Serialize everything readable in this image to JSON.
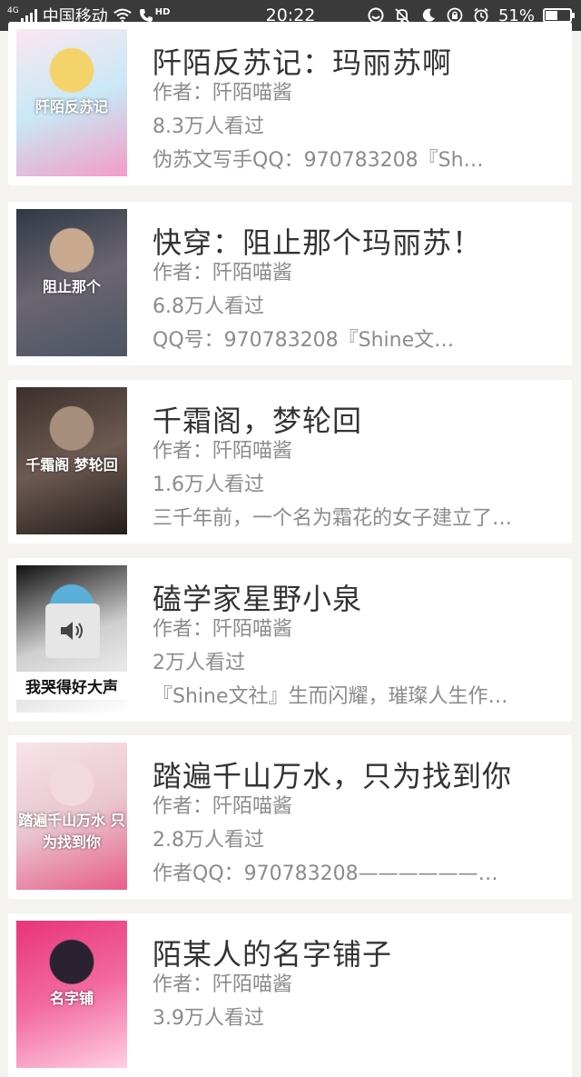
{
  "status_bar": {
    "network_tag": "4G",
    "carrier": "中国移动",
    "hd_tag": "HD",
    "time": "20:22",
    "battery_percent": "51%",
    "battery_level": 0.51,
    "icons": [
      "signal-icon",
      "wifi-icon",
      "call-icon",
      "face-icon",
      "mute-icon",
      "moon-icon",
      "lock-rotate-icon",
      "alarm-icon",
      "battery-icon"
    ]
  },
  "books": [
    {
      "title": "阡陌反苏记：玛丽苏啊",
      "author": "作者：阡陌喵酱",
      "views": "8.3万人看过",
      "desc": "伪苏文写手QQ：970783208『Sh…",
      "cover_text": "阡陌反苏记",
      "cover_colors": [
        "#fbe7f0",
        "#c9e8f6",
        "#f5d36b",
        "#f39cc6"
      ]
    },
    {
      "title": "快穿：阻止那个玛丽苏！",
      "author": "作者：阡陌喵酱",
      "views": "6.8万人看过",
      "desc": "QQ号：970783208『Shine文…",
      "cover_text": "阻止那个",
      "cover_colors": [
        "#2f3945",
        "#6b6570",
        "#c9a98f",
        "#4c5563"
      ]
    },
    {
      "title": "千霜阁，梦轮回",
      "author": "作者：阡陌喵酱",
      "views": "1.6万人看过",
      "desc": "三千年前，一个名为霜花的女子建立了…",
      "cover_text": "千霜阁 梦轮回",
      "cover_colors": [
        "#3b2f2c",
        "#6d5a52",
        "#a88f7c",
        "#241d1c"
      ]
    },
    {
      "title": "磕学家星野小泉",
      "author": "作者：阡陌喵酱",
      "views": "2万人看过",
      "desc": "『Shine文社』生而闪耀，璀璨人生作…",
      "cover_text": "我哭得好大声",
      "cover_colors": [
        "#111111",
        "#cfcfcf",
        "#5ab0d8",
        "#ffffff"
      ]
    },
    {
      "title": "踏遍千山万水，只为找到你",
      "author": "作者：阡陌喵酱",
      "views": "2.8万人看过",
      "desc": "作者QQ：970783208——————…",
      "cover_text": "踏遍千山万水 只为找到你",
      "cover_colors": [
        "#f7e4e8",
        "#e9c6cf",
        "#f2d9df",
        "#e85d8a"
      ]
    },
    {
      "title": "陌某人的名字铺子",
      "author": "作者：阡陌喵酱",
      "views": "3.9万人看过",
      "desc": "",
      "cover_text": "名字铺",
      "cover_colors": [
        "#e8347a",
        "#f26aa0",
        "#2a2230",
        "#ffd0e2"
      ]
    }
  ]
}
